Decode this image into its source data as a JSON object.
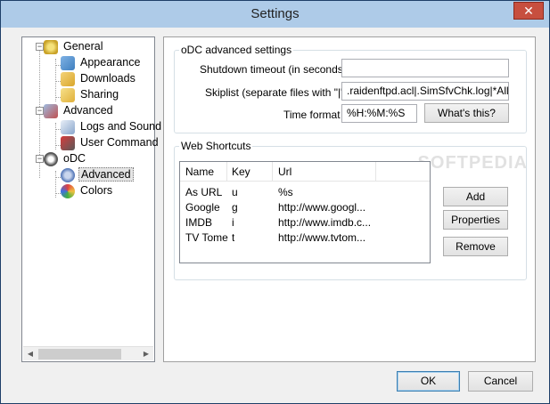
{
  "window": {
    "title": "Settings",
    "close_glyph": "✕"
  },
  "tree": {
    "items": [
      {
        "label": "General",
        "icon": "general-icon",
        "expander": "−"
      },
      {
        "label": "Appearance",
        "icon": "appearance-icon"
      },
      {
        "label": "Downloads",
        "icon": "downloads-icon"
      },
      {
        "label": "Sharing",
        "icon": "sharing-icon"
      },
      {
        "label": "Advanced",
        "icon": "advanced-icon",
        "expander": "−"
      },
      {
        "label": "Logs and Sound",
        "icon": "logs-icon"
      },
      {
        "label": "User Command",
        "icon": "user-command-icon"
      },
      {
        "label": "oDC",
        "icon": "odc-icon",
        "expander": "−"
      },
      {
        "label": "Advanced",
        "icon": "gear-icon"
      },
      {
        "label": "Colors",
        "icon": "colors-icon"
      }
    ],
    "scroll_left": "◀",
    "scroll_right": "▶"
  },
  "odc_settings": {
    "group_title": "oDC advanced settings",
    "shutdown_label": "Shutdown timeout (in seconds)",
    "shutdown_value": "",
    "skiplist_label": "Skiplist (separate files with \"|\")",
    "skiplist_value": ".raidenftpd.acl|.SimSfvChk.log|*All-Fi",
    "timeformat_label": "Time format",
    "timeformat_value": "%H:%M:%S",
    "whats_this_label": "What's this?"
  },
  "web_shortcuts": {
    "group_title": "Web Shortcuts",
    "columns": [
      "Name",
      "Key",
      "Url"
    ],
    "rows": [
      {
        "name": "As URL",
        "key": "u",
        "url": "%s"
      },
      {
        "name": "Google",
        "key": "g",
        "url": "http://www.googl..."
      },
      {
        "name": "IMDB",
        "key": "i",
        "url": "http://www.imdb.c..."
      },
      {
        "name": "TV Tome",
        "key": "t",
        "url": "http://www.tvtom..."
      }
    ],
    "add_label": "Add",
    "properties_label": "Properties",
    "remove_label": "Remove"
  },
  "footer": {
    "ok_label": "OK",
    "cancel_label": "Cancel"
  },
  "watermark": "SOFTPEDIA"
}
